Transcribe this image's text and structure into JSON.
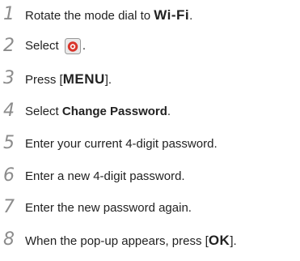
{
  "steps": [
    {
      "number": "1",
      "text": "Rotate the mode dial to ",
      "mode": "Wi-Fi",
      "end": "."
    },
    {
      "number": "2",
      "text": "Select ",
      "icon": "email-icon",
      "end": "."
    },
    {
      "number": "3",
      "text": "Press [",
      "key": "MENU",
      "end": "]."
    },
    {
      "number": "4",
      "text": "Select ",
      "option": "Change Password",
      "end": "."
    },
    {
      "number": "5",
      "text": "Enter your current 4-digit password."
    },
    {
      "number": "6",
      "text": "Enter a new 4-digit password."
    },
    {
      "number": "7",
      "text": "Enter the new password again."
    },
    {
      "number": "8",
      "text": "When the pop-up appears, press [",
      "key": "OK",
      "end": "]."
    }
  ],
  "colors": {
    "step_number": "#8c8c8c",
    "text": "#222222",
    "icon_red": "#d9352b"
  }
}
